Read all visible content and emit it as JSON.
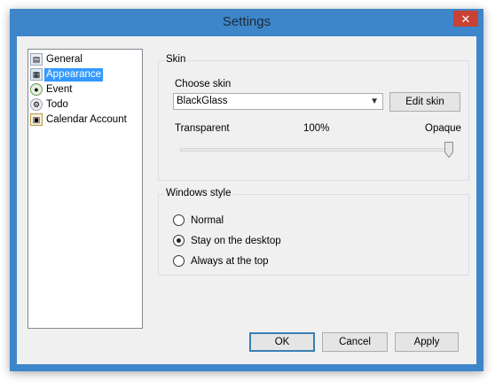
{
  "window": {
    "title": "Settings",
    "close_glyph": "✕"
  },
  "tree": {
    "items": [
      {
        "label": "General",
        "icon": "general-icon",
        "selected": false
      },
      {
        "label": "Appearance",
        "icon": "appearance-icon",
        "selected": true
      },
      {
        "label": "Event",
        "icon": "event-icon",
        "selected": false
      },
      {
        "label": "Todo",
        "icon": "todo-icon",
        "selected": false
      },
      {
        "label": "Calendar Account",
        "icon": "calendar-account-icon",
        "selected": false
      }
    ]
  },
  "skin": {
    "group_title": "Skin",
    "choose_label": "Choose skin",
    "selected_skin": "BlackGlass",
    "edit_button": "Edit skin",
    "transparent_label": "Transparent",
    "opacity_value": "100%",
    "opaque_label": "Opaque",
    "slider_fraction": 1.0
  },
  "windows_style": {
    "group_title": "Windows style",
    "options": [
      {
        "label": "Normal",
        "checked": false
      },
      {
        "label": "Stay on the desktop",
        "checked": true
      },
      {
        "label": "Always at the top",
        "checked": false
      }
    ]
  },
  "footer": {
    "ok": "OK",
    "cancel": "Cancel",
    "apply": "Apply"
  },
  "colors": {
    "titlebar": "#3d86c9",
    "close_button": "#c94234",
    "selection": "#3399ff"
  }
}
